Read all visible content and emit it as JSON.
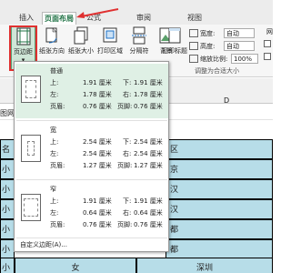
{
  "tabs": [
    {
      "label": "插入",
      "active": false
    },
    {
      "label": "页面布局",
      "active": true
    },
    {
      "label": "公式",
      "active": false
    },
    {
      "label": "审阅",
      "active": false
    },
    {
      "label": "视图",
      "active": false
    }
  ],
  "ribbon": {
    "buttons": [
      {
        "label": "页边距",
        "icon": "margins-icon"
      },
      {
        "label": "纸张方向",
        "icon": "orientation-icon"
      },
      {
        "label": "纸张大小",
        "icon": "paper-size-icon"
      },
      {
        "label": "打印区域",
        "icon": "print-area-icon"
      },
      {
        "label": "分隔符",
        "icon": "breaks-icon"
      },
      {
        "label": "背景",
        "icon": "background-icon"
      },
      {
        "label": "打印标题",
        "icon": "print-titles-icon"
      }
    ],
    "scale": {
      "width_label": "宽度:",
      "width_value": "自动",
      "height_label": "高度:",
      "height_value": "自动",
      "scale_label": "缩放比例:",
      "scale_value": "100%",
      "group_label": "调整为合适大小"
    },
    "side_letters": [
      "网",
      "网"
    ]
  },
  "sheet": {
    "col_header": "D",
    "grid_label": "图网",
    "left_cells": [
      "名",
      "小园",
      "小兔",
      "小依",
      "小思",
      "小月",
      "小璇"
    ],
    "right_cells": [
      "区",
      "京",
      "汉",
      "汉",
      "都",
      "都",
      "深圳"
    ],
    "bottom_middle": "女"
  },
  "margins_menu": {
    "options": [
      {
        "name": "普通",
        "top_label": "上:",
        "top": "1.91 厘米",
        "bottom_label": "下:",
        "bottom": "1.91 厘米",
        "left_label": "左:",
        "left": "1.78 厘米",
        "right_label": "右:",
        "right": "1.78 厘米",
        "header_label": "页眉:",
        "header": "0.76 厘米",
        "footer_label": "页脚:",
        "footer": "0.76 厘米",
        "highlighted": true
      },
      {
        "name": "宽",
        "top_label": "上:",
        "top": "2.54 厘米",
        "bottom_label": "下:",
        "bottom": "2.54 厘米",
        "left_label": "左:",
        "left": "2.54 厘米",
        "right_label": "右:",
        "right": "2.54 厘米",
        "header_label": "页眉:",
        "header": "1.27 厘米",
        "footer_label": "页脚:",
        "footer": "1.27 厘米",
        "highlighted": false
      },
      {
        "name": "窄",
        "top_label": "上:",
        "top": "1.91 厘米",
        "bottom_label": "下:",
        "bottom": "1.91 厘米",
        "left_label": "左:",
        "left": "0.64 厘米",
        "right_label": "右:",
        "right": "0.64 厘米",
        "header_label": "页眉:",
        "header": "0.76 厘米",
        "footer_label": "页脚:",
        "footer": "0.76 厘米",
        "highlighted": false
      }
    ],
    "custom": "自定义边距(A)..."
  },
  "colors": {
    "accent": "#217346",
    "highlight": "#dff0e5",
    "cell_fill": "#b7dde8",
    "annotation": "#e03030"
  }
}
